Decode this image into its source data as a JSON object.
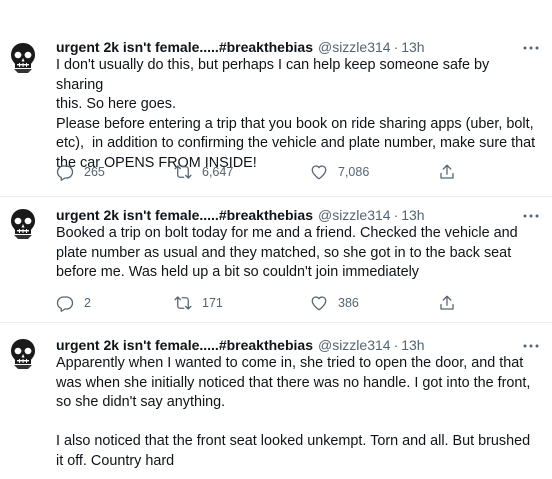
{
  "tweets": [
    {
      "display_name": "urgent 2k isn't female.....#breakthebias",
      "handle": "@sizzle314",
      "separator": "·",
      "time": "13h",
      "text": "I don't usually do this, but perhaps I can help keep someone safe by sharing\nthis. So here goes.\nPlease before entering a trip that you book on ride sharing apps (uber, bolt,\netc),  in addition to confirming the vehicle and plate number, make sure that\nthe car OPENS FROM INSIDE!",
      "replies": "265",
      "retweets": "6,647",
      "likes": "7,086"
    },
    {
      "display_name": "urgent 2k isn't female.....#breakthebias",
      "handle": "@sizzle314",
      "separator": "·",
      "time": "13h",
      "text": "Booked a trip on bolt today for me and a friend. Checked the vehicle and\nplate number as usual and they matched, so she got in to the back seat\nbefore me. Was held up a bit so couldn't join immediately",
      "replies": "2",
      "retweets": "171",
      "likes": "386"
    },
    {
      "display_name": "urgent 2k isn't female.....#breakthebias",
      "handle": "@sizzle314",
      "separator": "·",
      "time": "13h",
      "text": "Apparently when I wanted to come in, she tried to open the door, and that\nwas when she initially noticed that there was no handle. I got into the front,\nso she didn't say anything.\n\nI also noticed that the front seat looked unkempt. Torn and all. But brushed\nit off. Country hard"
    }
  ],
  "icons": {
    "reply": "reply-icon",
    "retweet": "retweet-icon",
    "like": "heart-icon",
    "share": "share-icon",
    "more": "more-options-icon",
    "avatar": "skull-avatar"
  },
  "colors": {
    "text": "#0f1419",
    "secondary": "#536471",
    "divider": "#e6ecf0"
  }
}
